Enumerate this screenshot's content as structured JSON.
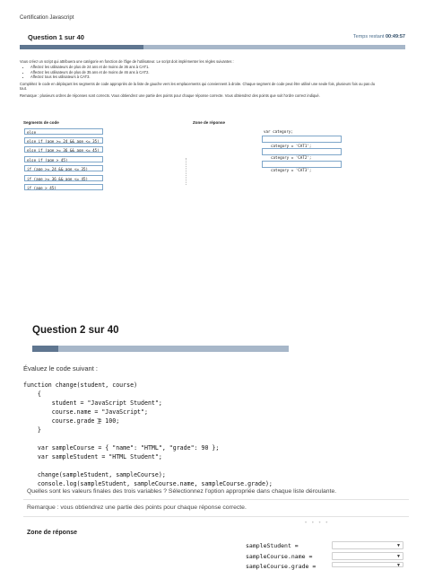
{
  "doc": {
    "header": "Certification Javascript"
  },
  "q1": {
    "title": "Question 1 sur 40",
    "timer_label": "Temps restant",
    "timer_value": "00:49:57",
    "progress": 0.32,
    "intro": "Vous créez un script qui attribuera une catégorie en fonction de l'âge de l'utilisateur. Le script doit implémenter les règles suivantes :",
    "rules": [
      "Affectez les utilisateurs de plus de 24 ans et de moins de 36 ans à CAT1.",
      "Affectez les utilisateurs de plus de 35 ans et de moins de 46 ans à CAT2.",
      "Affectez tous les utilisateurs à CAT3."
    ],
    "instruction": "Complétez le code en déplaçant les segments de code appropriés de la liste de gauche vers les emplacements qui conviennent à droite. Chaque segment de code peut être utilisé une seule fois, plusieurs fois ou pas du tout.",
    "remark": "Remarque : plusieurs ordres de réponses sont corrects. Vous obtiendrez une partie des points pour chaque réponse correcte. Vous obtiendrez des points que soit l'ordre correct indiqué.",
    "segments_title": "Segments de code",
    "zone_title": "Zone de réponse",
    "segments": [
      "else",
      "else if (age >= 24 && age <= 35)",
      "else if (age >= 36 && age <= 45)",
      "else if (age > 45)",
      "if (age >= 24 && age <= 35)",
      "if (age >= 36 && age <= 45)",
      "if (age > 45)"
    ],
    "zone_lines": [
      "var category;",
      "category = 'CAT1';",
      "category = 'CAT2';",
      "category = 'CAT3';"
    ]
  },
  "q2": {
    "title": "Question 2 sur 40",
    "progress": 0.1,
    "intro": "Évaluez le code suivant :",
    "code": "function change(student, course)\n    {\n        student = \"JavaScript Student\";\n        course.name = \"JavaScript\";\n        course.grade = 100;\n    }\n\n    var sampleCourse = { \"name\": \"HTML\", \"grade\": 90 };\n    var sampleStudent = \"HTML Student\";\n\n    change(sampleStudent, sampleCourse);\n    console.log(sampleStudent, sampleCourse.name, sampleCourse.grade);",
    "question": "Quelles sont les valeurs finales des trois variables ? Sélectionnez l'option appropriée dans chaque liste déroulante.",
    "note": "Remarque : vous obtiendrez une partie des points pour chaque réponse correcte.",
    "zone_title": "Zone de réponse",
    "answers": [
      {
        "label": "sampleStudent =",
        "value": ""
      },
      {
        "label": "sampleCourse.name =",
        "value": ""
      },
      {
        "label": "sampleCourse.grade =",
        "value": ""
      }
    ]
  },
  "icons": {
    "caret": "caret-down-icon",
    "cursor": "text-cursor-icon"
  },
  "colors": {
    "accent": "#5f7690",
    "bar": "#a7b7c9",
    "border": "#7ea6c9",
    "timer": "#4a6d8c"
  }
}
